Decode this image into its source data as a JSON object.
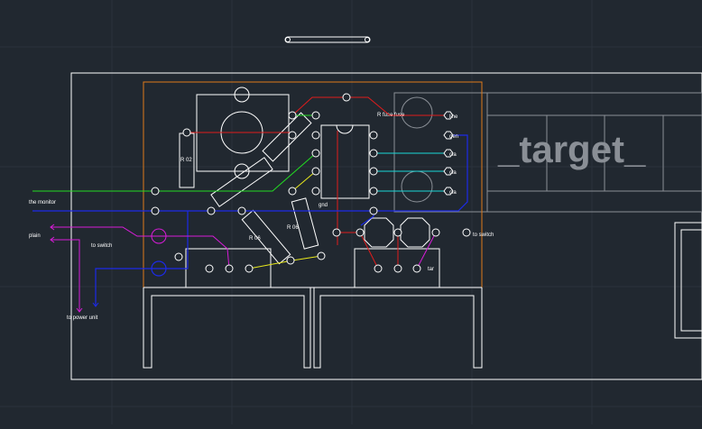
{
  "app": "CAD model space viewport",
  "colors": {
    "background": "#212830",
    "grid_major": "#2c3440",
    "grid_minor": "#262d36",
    "white": "#ffffff",
    "orange": "#e07a1a",
    "red": "#e01c1c",
    "green": "#22dd22",
    "blue": "#1c2ae8",
    "cyan": "#19d9d9",
    "yellow": "#e8e81c",
    "magenta": "#d81cd8",
    "gray": "#8a8f96"
  },
  "drawing": {
    "watermark": "_target_",
    "labels": {
      "r_left": "R 02",
      "r_mid1": "R 06",
      "r_mid2": "R 06",
      "gnd": "gnd",
      "fuse": "R fuse fuse",
      "out1": "line",
      "out2": "gen",
      "out3": "cla",
      "out4": "cla",
      "out5": "cla",
      "monitor": "the monitor",
      "plain": "plain",
      "to_switch_left": "to switch",
      "to_power_unit": "to power unit",
      "to_switch_right": "to switch",
      "bottom_right": "tar"
    }
  }
}
